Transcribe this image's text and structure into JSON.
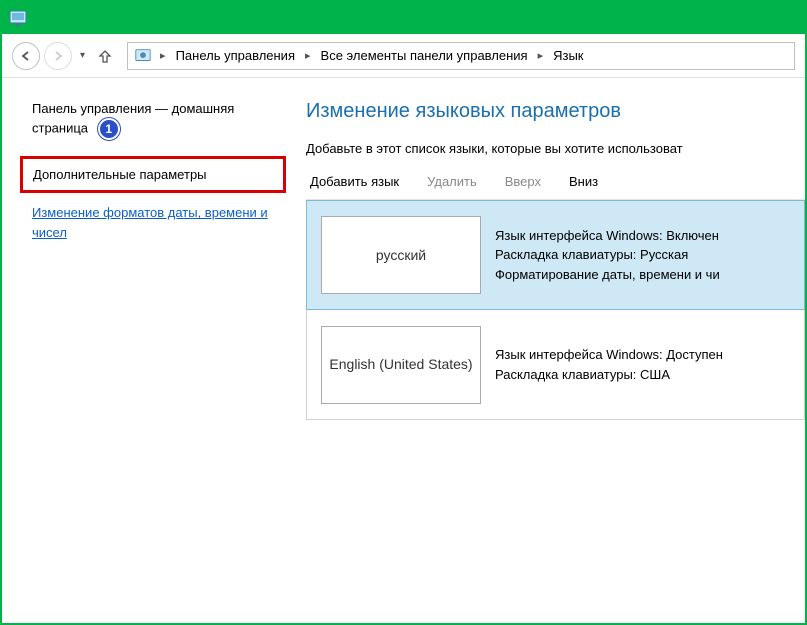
{
  "titlebar": {},
  "breadcrumb": {
    "items": [
      "Панель управления",
      "Все элементы панели управления",
      "Язык"
    ]
  },
  "sidebar": {
    "home": "Панель управления — домашняя страница",
    "badge": "1",
    "highlighted": "Дополнительные параметры",
    "link2": "Изменение форматов даты, времени и чисел"
  },
  "main": {
    "title": "Изменение языковых параметров",
    "desc": "Добавьте в этот список языки, которые вы хотите использоват",
    "toolbar": {
      "add": "Добавить язык",
      "remove": "Удалить",
      "up": "Вверх",
      "down": "Вниз"
    },
    "languages": [
      {
        "name": "русский",
        "info1": "Язык интерфейса Windows: Включен",
        "info2": "Раскладка клавиатуры: Русская",
        "info3": "Форматирование даты, времени и чи",
        "selected": true
      },
      {
        "name": "English (United States)",
        "info1": "Язык интерфейса Windows: Доступен",
        "info2": "Раскладка клавиатуры: США",
        "info3": "",
        "selected": false
      }
    ]
  }
}
